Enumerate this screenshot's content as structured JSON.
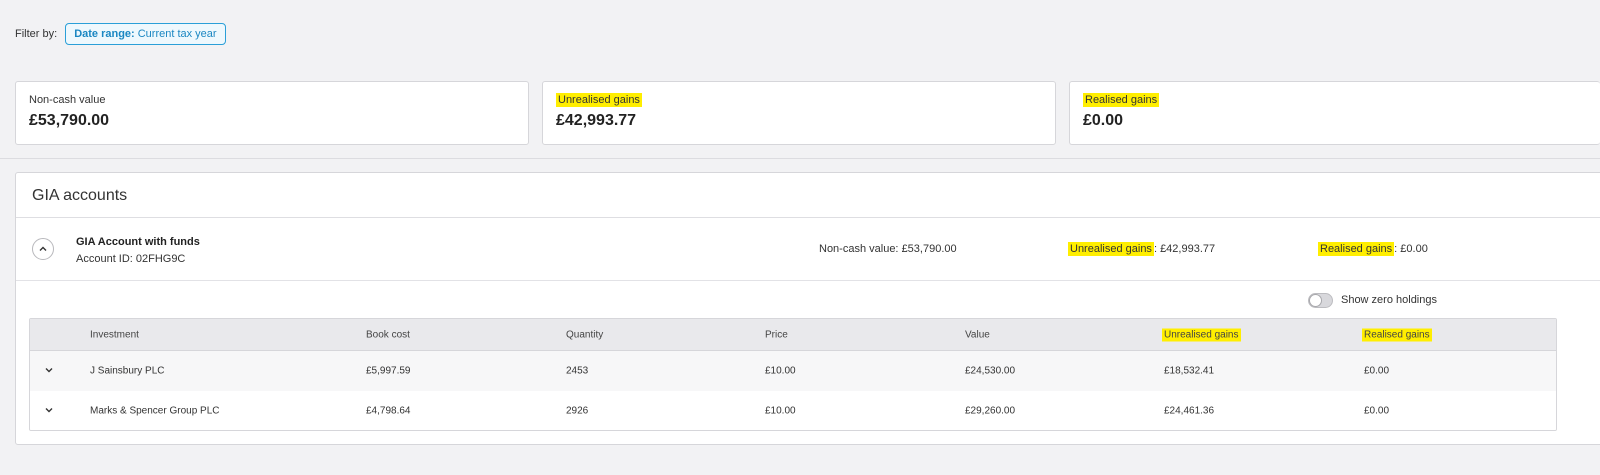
{
  "filter": {
    "label": "Filter by:",
    "chip_key": "Date range:",
    "chip_value": "Current tax year"
  },
  "summary": {
    "non_cash": {
      "label": "Non-cash value",
      "value": "£53,790.00"
    },
    "unrealised": {
      "label": "Unrealised gains",
      "value": "£42,993.77"
    },
    "realised": {
      "label": "Realised gains",
      "value": "£0.00"
    }
  },
  "panel": {
    "title": "GIA accounts",
    "account": {
      "name": "GIA Account with funds",
      "id_label": "Account ID:",
      "id_value": "02FHG9C",
      "non_cash_label": "Non-cash value:",
      "non_cash_value": "£53,790.00",
      "unrealised_label": "Unrealised gains",
      "unrealised_value": "£42,993.77",
      "realised_label": "Realised gains",
      "realised_value": "£0.00"
    },
    "toggle_label": "Show zero holdings",
    "columns": [
      "Investment",
      "Book cost",
      "Quantity",
      "Price",
      "Value",
      "Unrealised gains",
      "Realised gains"
    ],
    "rows": [
      [
        "J Sainsbury PLC",
        "£5,997.59",
        "2453",
        "£10.00",
        "£24,530.00",
        "£18,532.41",
        "£0.00"
      ],
      [
        "Marks & Spencer Group PLC",
        "£4,798.64",
        "2926",
        "£10.00",
        "£29,260.00",
        "£24,461.36",
        "£0.00"
      ]
    ]
  },
  "colors": {
    "highlight": "#ffee00",
    "accent": "#1b87c2"
  },
  "icons": {
    "collapse": "chevron-up-icon",
    "expand": "chevron-down-icon"
  }
}
